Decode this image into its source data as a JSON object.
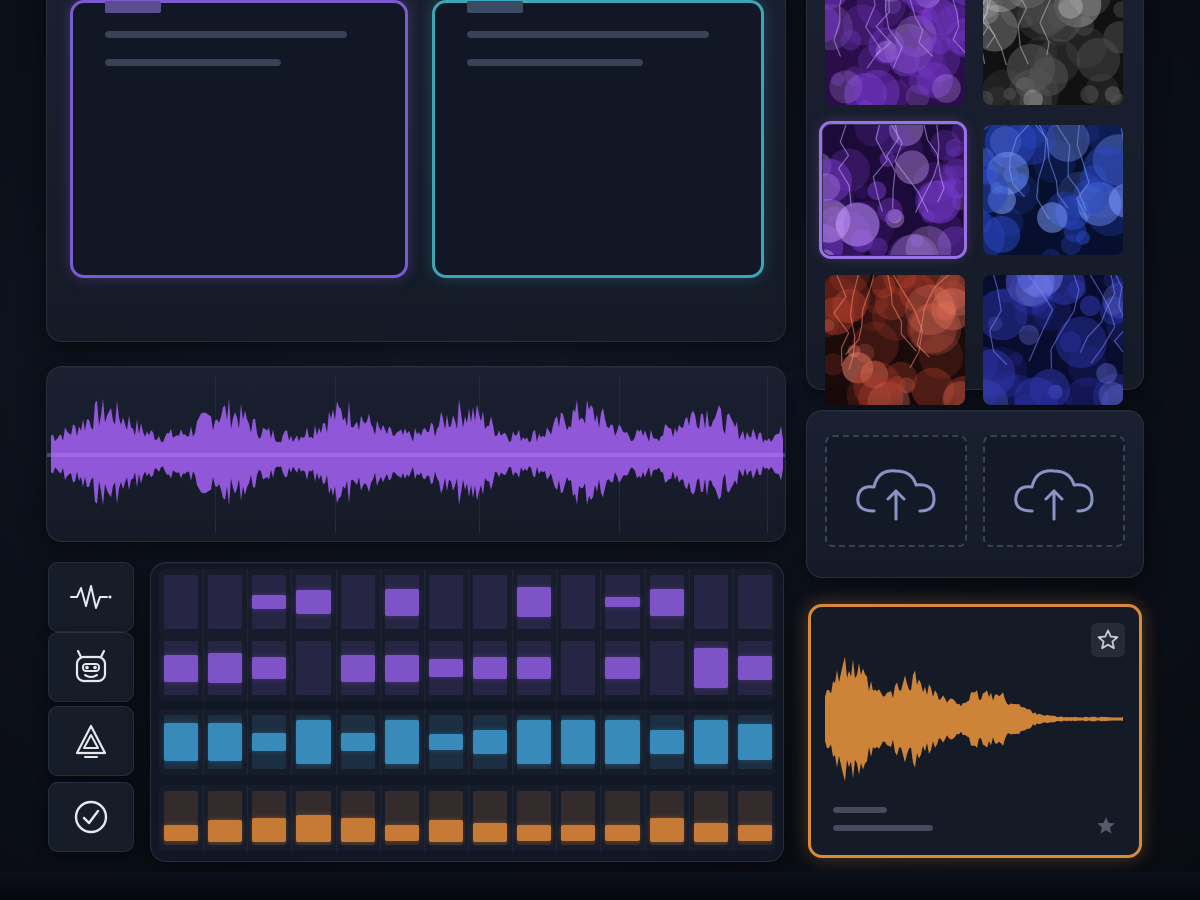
{
  "theme": {
    "purple": "#7c5ad0",
    "teal": "#3ca5b6",
    "orange": "#d78a3a",
    "blue": "#3d9bd0",
    "background": "#0c1019"
  },
  "cards": [
    {
      "name": "card-purple",
      "accent": "#7c5ad0",
      "caption": ""
    },
    {
      "name": "card-teal",
      "accent": "#3ca5b6",
      "caption": ""
    }
  ],
  "sidebar_tools": [
    {
      "icon": "waveform-icon"
    },
    {
      "icon": "robot-face-icon"
    },
    {
      "icon": "recycle-triangle-icon"
    },
    {
      "icon": "check-circle-icon"
    }
  ],
  "sequencer": {
    "columns": 14,
    "rows": [
      {
        "color": "#8e5ce0",
        "levels": [
          0.0,
          0.0,
          0.25,
          0.45,
          0.0,
          0.5,
          0.0,
          0.0,
          0.55,
          0.0,
          0.2,
          0.5,
          0.0,
          0.0
        ]
      },
      {
        "color": "#8e5ce0",
        "levels": [
          0.5,
          0.55,
          0.4,
          0.0,
          0.5,
          0.5,
          0.35,
          0.4,
          0.4,
          0.0,
          0.4,
          0.0,
          0.75,
          0.45
        ]
      },
      {
        "color": "#3d9bd0",
        "levels": [
          0.7,
          0.7,
          0.35,
          0.8,
          0.35,
          0.8,
          0.3,
          0.45,
          0.8,
          0.8,
          0.8,
          0.45,
          0.8,
          0.65
        ]
      },
      {
        "color": "#e08838",
        "levels": [
          0.3,
          0.4,
          0.45,
          0.5,
          0.45,
          0.3,
          0.4,
          0.35,
          0.3,
          0.3,
          0.3,
          0.45,
          0.35,
          0.3
        ]
      }
    ]
  },
  "gallery": {
    "thumbnails": [
      {
        "name": "thumb-purple-storm-top",
        "palette": [
          "#2a0e4a",
          "#7a3ad0",
          "#c89cff"
        ]
      },
      {
        "name": "thumb-gray-smoke",
        "palette": [
          "#111111",
          "#555555",
          "#c0c0c0"
        ]
      },
      {
        "name": "thumb-purple-city",
        "palette": [
          "#1c0a38",
          "#7438c8",
          "#d2a8ff"
        ],
        "selected": true
      },
      {
        "name": "thumb-blue-clouds",
        "palette": [
          "#06102e",
          "#2a46c2",
          "#7c9cff"
        ]
      },
      {
        "name": "thumb-red-clouds",
        "palette": [
          "#1a0a0a",
          "#a83a2a",
          "#ff8870"
        ]
      },
      {
        "name": "thumb-indigo-clouds",
        "palette": [
          "#080c2e",
          "#3038b2",
          "#8088ff"
        ]
      }
    ]
  },
  "upload": {
    "slots": [
      {
        "icon": "cloud-upload-icon"
      },
      {
        "icon": "cloud-upload-icon"
      }
    ]
  },
  "audio_card": {
    "accent": "#d78a3a",
    "caption": "",
    "icons": [
      "star-outline-icon",
      "star-filled-icon"
    ]
  }
}
